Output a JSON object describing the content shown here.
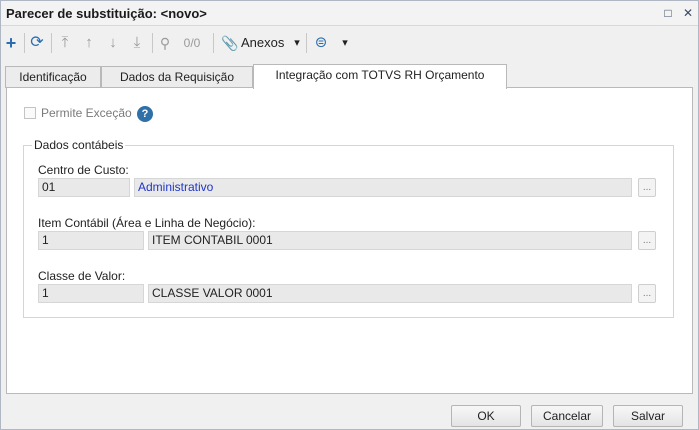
{
  "window": {
    "title": "Parecer de substituição: <novo>",
    "restore_glyph": "□",
    "close_glyph": "✕"
  },
  "toolbar": {
    "add_icon": "plus-icon",
    "refresh_icon": "refresh-icon",
    "move_top_icon": "move-top-icon",
    "move_up_icon": "move-up-icon",
    "move_down_icon": "move-down-icon",
    "move_bottom_icon": "move-bottom-icon",
    "search_icon": "search-icon",
    "record_counter": "0/0",
    "attachments_label": "Anexos",
    "attachments_icon": "paperclip-icon",
    "more_icon": "options-icon",
    "dropdown_glyph": "▾"
  },
  "tabs": [
    {
      "label": "Identificação"
    },
    {
      "label": "Dados da Requisição"
    },
    {
      "label": "Integração com TOTVS RH Orçamento"
    }
  ],
  "form": {
    "permite_excecao_label": "Permite Exceção",
    "permite_excecao_checked": false,
    "help_glyph": "?",
    "group_title": "Dados contábeis",
    "fields": [
      {
        "label": "Centro de Custo:",
        "code": "01",
        "description": "Administrativo",
        "lookup": "..."
      },
      {
        "label": "Item Contábil (Área e Linha de Negócio):",
        "code": "1",
        "description": "ITEM CONTABIL 0001",
        "lookup": "..."
      },
      {
        "label": "Classe de Valor:",
        "code": "1",
        "description": "CLASSE VALOR 0001",
        "lookup": "..."
      }
    ]
  },
  "footer": {
    "ok_label": "OK",
    "cancel_label": "Cancelar",
    "save_label": "Salvar"
  },
  "colors": {
    "accent": "#2f70a8",
    "link": "#1f35c9",
    "field_bg": "#e9e9e9"
  }
}
